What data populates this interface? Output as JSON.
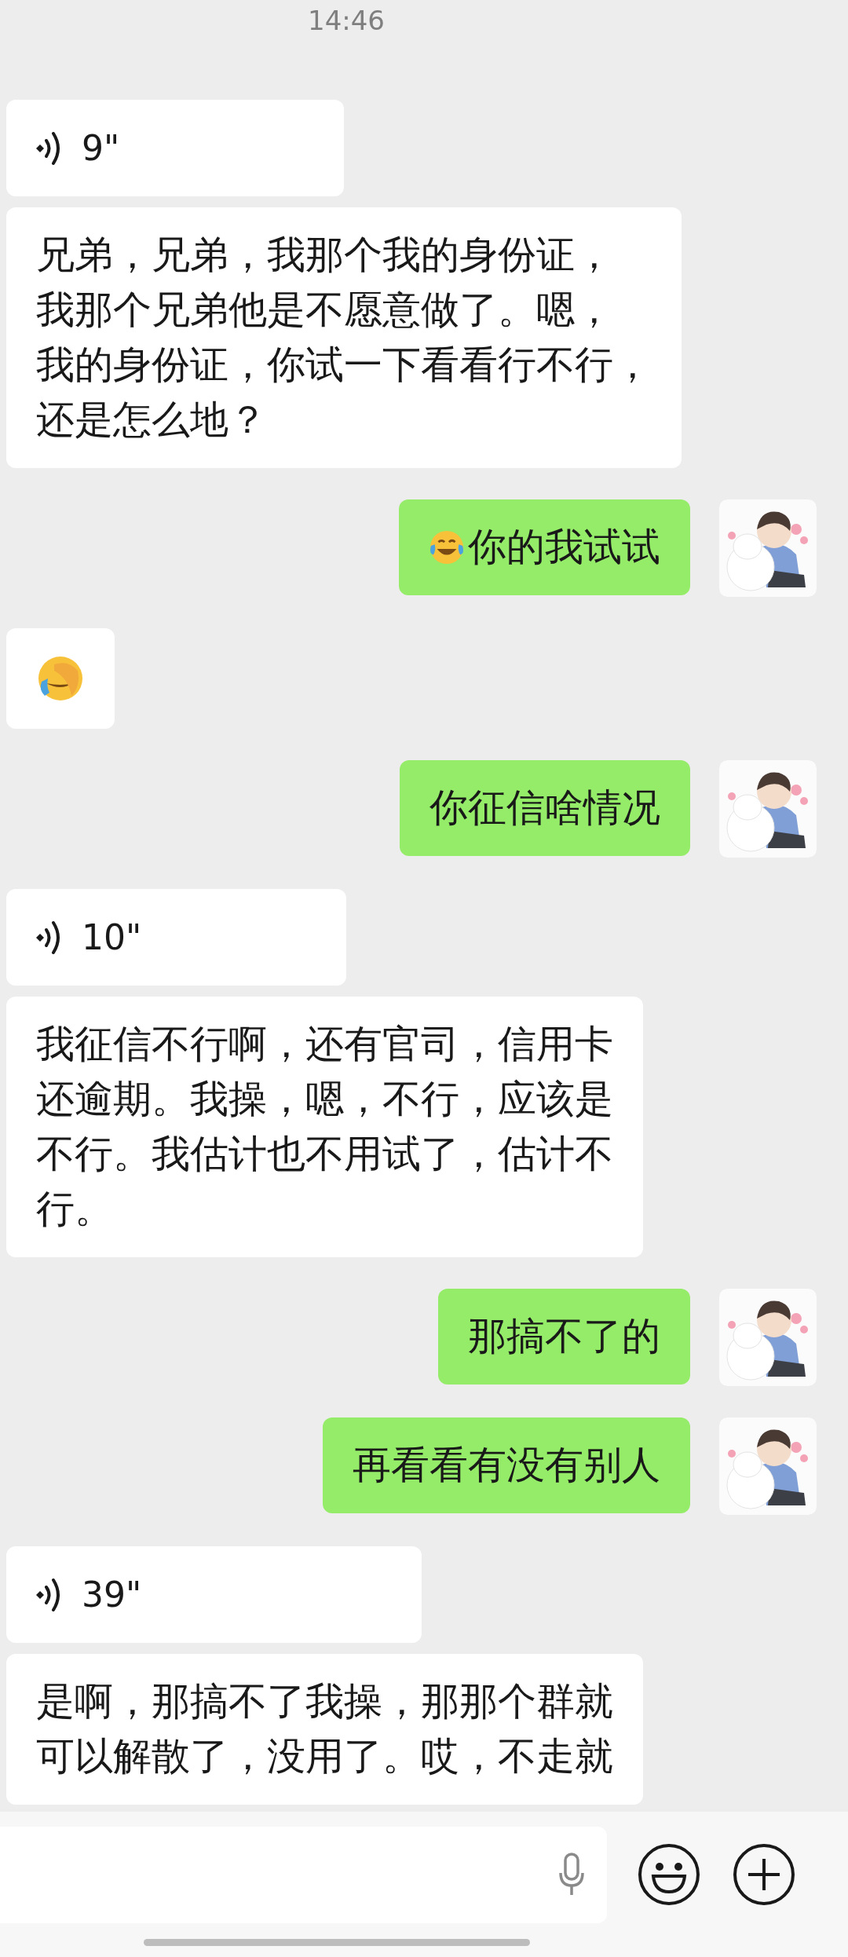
{
  "time": "14:46",
  "messages": [
    {
      "outgoing": false,
      "kind": "voice",
      "duration": "9\""
    },
    {
      "outgoing": false,
      "kind": "text",
      "lines": [
        "兄弟，兄弟，我那个我的身份证，",
        "我那个兄弟他是不愿意做了。嗯，",
        "我的身份证，你试一下看看行不行，",
        "还是怎么地？"
      ]
    },
    {
      "outgoing": true,
      "kind": "emoji_text",
      "lines": [
        "你的我试试"
      ]
    },
    {
      "outgoing": false,
      "kind": "emoji"
    },
    {
      "outgoing": true,
      "kind": "text",
      "lines": [
        "你征信啥情况"
      ]
    },
    {
      "outgoing": false,
      "kind": "voice",
      "duration": "10\""
    },
    {
      "outgoing": false,
      "kind": "text",
      "lines": [
        "我征信不行啊，还有官司，信用卡",
        "还逾期。我操，嗯，不行，应该是",
        "不行。我估计也不用试了，估计不",
        "行。"
      ]
    },
    {
      "outgoing": true,
      "kind": "text",
      "lines": [
        "那搞不了的"
      ]
    },
    {
      "outgoing": true,
      "kind": "text",
      "lines": [
        "再看看有没有别人"
      ]
    },
    {
      "outgoing": false,
      "kind": "voice",
      "duration": "39\""
    },
    {
      "outgoing": false,
      "kind": "text",
      "lines": [
        "是啊，那搞不了我操，那那个群就",
        "可以解散了，没用了。哎，不走就"
      ]
    }
  ]
}
